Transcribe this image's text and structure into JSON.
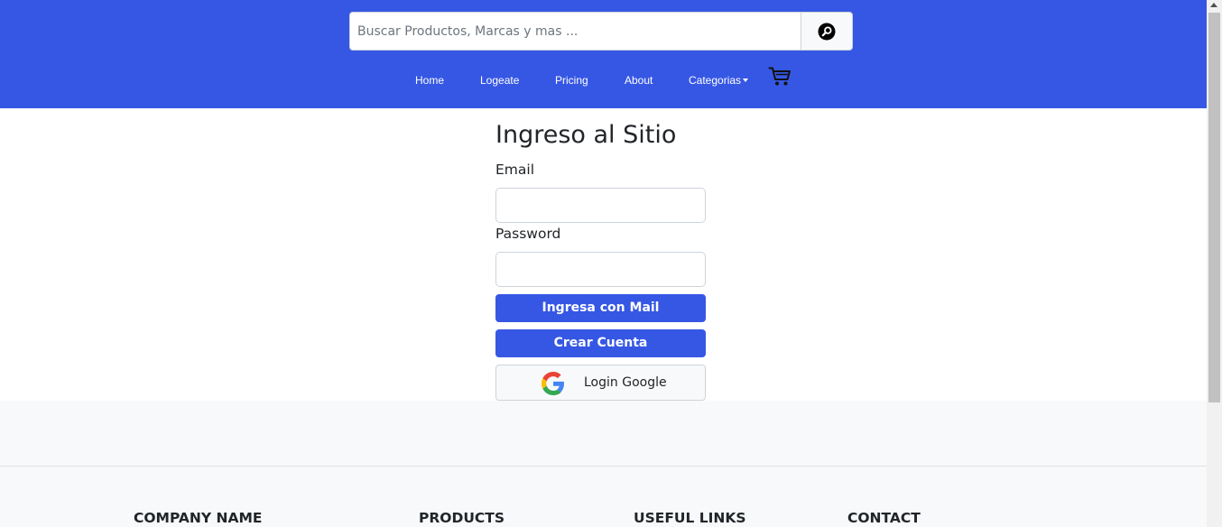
{
  "search": {
    "placeholder": "Buscar Productos, Marcas y mas ...",
    "button_icon": "search-icon"
  },
  "nav": {
    "items": [
      {
        "label": "Home"
      },
      {
        "label": "Logeate"
      },
      {
        "label": "Pricing"
      },
      {
        "label": "About"
      },
      {
        "label": "Categorias"
      }
    ],
    "cart_icon": "cart-icon"
  },
  "login": {
    "title": "Ingreso al Sitio",
    "email_label": "Email",
    "email_value": "",
    "password_label": "Password",
    "password_value": "",
    "mail_button": "Ingresa con Mail",
    "create_button": "Crear Cuenta",
    "google_button": "Login Google",
    "google_icon": "google-logo-icon"
  },
  "footer": {
    "headings": [
      "COMPANY NAME",
      "PRODUCTS",
      "USEFUL LINKS",
      "CONTACT"
    ]
  },
  "colors": {
    "brand": "#3657e4",
    "footer_bg": "#f8f9fa",
    "text": "#212529"
  }
}
